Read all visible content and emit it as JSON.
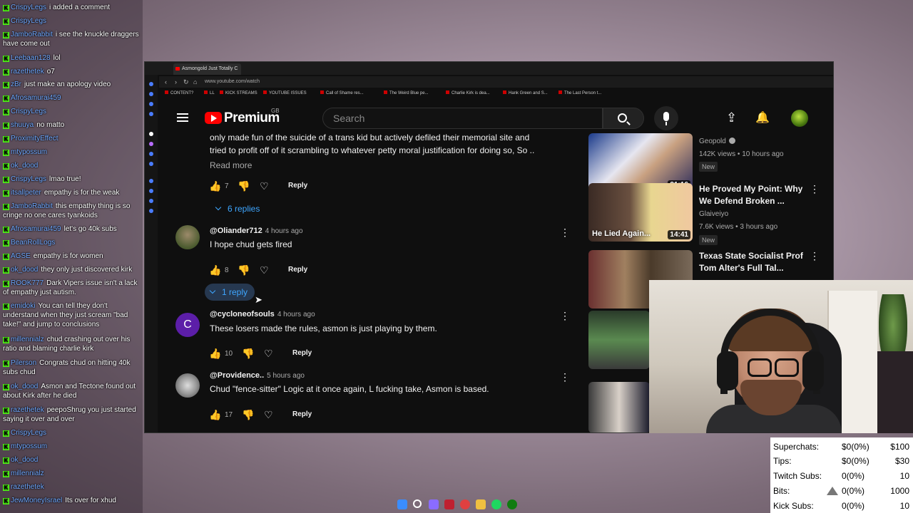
{
  "chat": [
    {
      "user": "CrispyLegs",
      "text": "i added a comment"
    },
    {
      "user": "CrispyLegs",
      "text": ""
    },
    {
      "user": "JamboRabbit",
      "text": "i see the knuckle draggers have come out"
    },
    {
      "user": "Leebaan128",
      "text": "lol"
    },
    {
      "user": "razethetek",
      "text": "o7"
    },
    {
      "user": "zBr",
      "text": "just make an apology video"
    },
    {
      "user": "Afrosamurai459",
      "text": ""
    },
    {
      "user": "CrispyLegs",
      "text": ""
    },
    {
      "user": "shuuya",
      "text": "no matto"
    },
    {
      "user": "ProximityEffect",
      "text": ""
    },
    {
      "user": "mtypossum",
      "text": ""
    },
    {
      "user": "ok_dood",
      "text": ""
    },
    {
      "user": "CrispyLegs",
      "text": "lmao true!"
    },
    {
      "user": "itsallpeter",
      "text": "empathy is for the weak"
    },
    {
      "user": "JamboRabbit",
      "text": "this empathy thing is so cringe no one cares tyankoids"
    },
    {
      "user": "Afrosamurai459",
      "text": "let's go 40k subs"
    },
    {
      "user": "BeanRollLogs",
      "text": ""
    },
    {
      "user": "AGSE",
      "text": "empathy is for women"
    },
    {
      "user": "ok_dood",
      "text": "they only just discovered kirk"
    },
    {
      "user": "ROOK777",
      "text": "Dark Vipers issue isn't a lack of empathy just autism."
    },
    {
      "user": "emidoki",
      "text": "You can tell they don't understand when they just scream \"bad take!\" and jump to conclusions"
    },
    {
      "user": "millennialz",
      "text": "chud crashing out over his ratio and blaming charlie kirk"
    },
    {
      "user": "Pilerson",
      "text": "Congrats chud on hitting 40k subs chud"
    },
    {
      "user": "ok_dood",
      "text": "Asmon and Tectone found out about Kirk after he died"
    },
    {
      "user": "razethetek",
      "text": "peepoShrug you just started saying it over and over"
    },
    {
      "user": "CrispyLegs",
      "text": ""
    },
    {
      "user": "mtypossum",
      "text": ""
    },
    {
      "user": "ok_dood",
      "text": ""
    },
    {
      "user": "millennialz",
      "text": ""
    },
    {
      "user": "razethetek",
      "text": ""
    },
    {
      "user": "JewMoneyIsrael",
      "text": "Its over for xhud"
    }
  ],
  "browser": {
    "tab_title": "Asmongold Just Totally C",
    "url": "www.youtube.com/watch",
    "bookmarks": [
      "CONTENT?",
      "LL",
      "KICK STREAMS",
      "YOUTUBE ISSUES",
      "Call of Shame res...",
      "The Weird Blue pe...",
      "Charlie Kirk is dea...",
      "Hank Green and S...",
      "The Last Person t..."
    ]
  },
  "youtube": {
    "logo": "Premium",
    "region": "GB",
    "search_placeholder": "Search"
  },
  "comments": {
    "first": {
      "text_line1": "only made fun of the suicide of a trans kid but actively defiled their memorial site and",
      "text_line2": "tried to profit off of it scrambling to whatever petty moral justification for doing so, So ..",
      "read_more": "Read more",
      "likes": "7",
      "reply": "Reply",
      "replies": "6 replies"
    },
    "items": [
      {
        "handle": "@Oliander712",
        "time": "4 hours ago",
        "text": "I hope chud gets fired",
        "likes": "8",
        "reply": "Reply",
        "replies": "1 reply"
      },
      {
        "handle": "@cycloneofsouls",
        "time": "4 hours ago",
        "text": "These losers made the rules, asmon is just playing by them.",
        "likes": "10",
        "reply": "Reply",
        "avatar_letter": "C"
      },
      {
        "handle": "@Providence..",
        "time": "5 hours ago",
        "text": "Chud \"fence-sitter\" Logic at it once again, L fucking take, Asmon is based.",
        "likes": "17",
        "reply": "Reply"
      }
    ]
  },
  "related": [
    {
      "title": "",
      "channel": "Geopold",
      "meta": "142K views • 10 hours ago",
      "badge": "New",
      "duration": "21:16"
    },
    {
      "title": "He Proved My Point: Why We Defend Broken ...",
      "channel": "Glaiveiyo",
      "meta": "7.6K views • 3 hours ago",
      "badge": "New",
      "duration": "14:41",
      "thumb_text": "He Lied Again..."
    },
    {
      "title": "Texas State Socialist Prof Tom Alter's Full Tal...",
      "channel": "",
      "meta": "",
      "badge": "",
      "duration": ""
    }
  ],
  "stats": [
    {
      "label": "Superchats:",
      "value": "$0(0%)",
      "goal": "$100"
    },
    {
      "label": "Tips:",
      "value": "$0(0%)",
      "goal": "$30"
    },
    {
      "label": "Twitch Subs:",
      "value": "0(0%)",
      "goal": "10"
    },
    {
      "label": "Bits:",
      "value": "0(0%)",
      "goal": "1000"
    },
    {
      "label": "Kick Subs:",
      "value": "0(0%)",
      "goal": "10"
    }
  ],
  "colors": {
    "youtube_red": "#ff0000",
    "link_blue": "#3ea6ff",
    "kick_green": "#53fc18",
    "chat_user": "#6fa8ff"
  }
}
